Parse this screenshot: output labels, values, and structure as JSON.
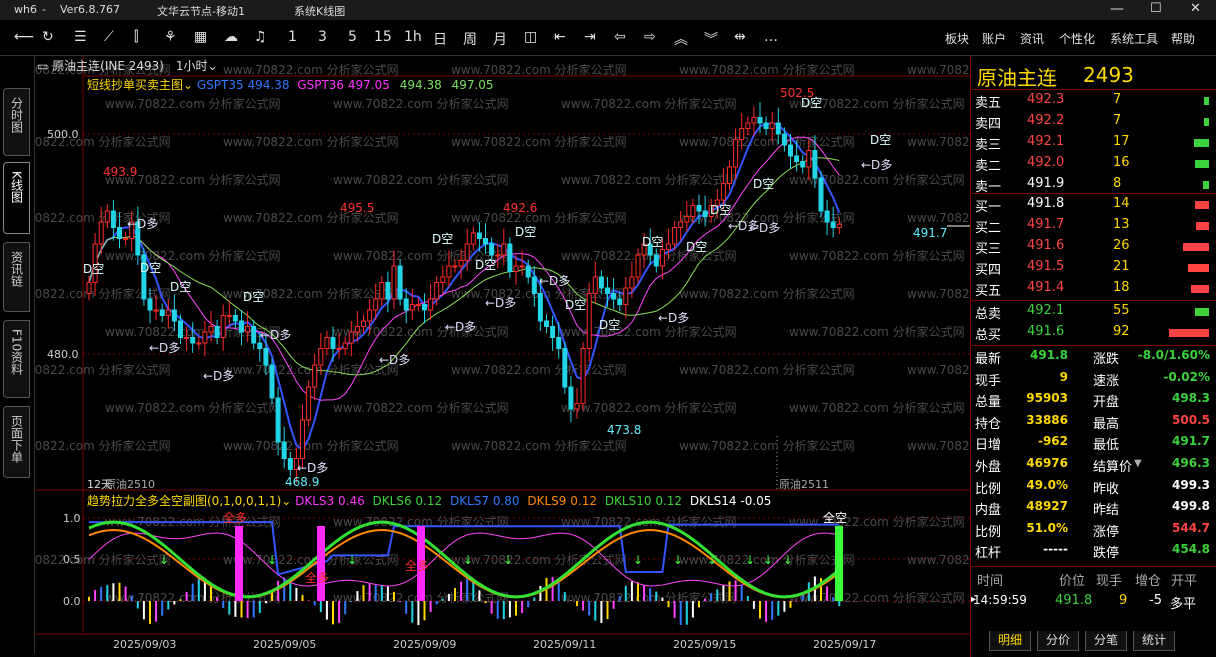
{
  "titlebar": {
    "user": "wh6",
    "dash": "-",
    "version": "Ver6.8.767",
    "node": "文华云节点-移动1",
    "view": "系统K线图",
    "minimize": "—",
    "maximize": "☐",
    "close": "✕"
  },
  "toolbar": {
    "periods": [
      "1",
      "3",
      "5",
      "15",
      "1h",
      "日",
      "周",
      "月"
    ],
    "menus": [
      "板块",
      "账户",
      "资讯",
      "个性化",
      "系统工具",
      "帮助"
    ],
    "more": "…"
  },
  "left_tabs": [
    "分时图",
    "K线图",
    "资讯链",
    "F10资料",
    "页面下单"
  ],
  "chart": {
    "symbol_title": "原油主连(INE 2493)",
    "interval": "1小时",
    "indicator_name": "短线抄单买卖主图",
    "indicator_values": [
      {
        "label": "GSPT35",
        "value": "494.38",
        "color": "#3377ff"
      },
      {
        "label": "GSPT36",
        "value": "497.05",
        "color": "#ff33ff"
      },
      {
        "label": "",
        "value": "494.38",
        "color": "#7be060"
      },
      {
        "label": "",
        "value": "497.05",
        "color": "#7be060"
      }
    ],
    "price_labels": [
      "500.0",
      "480.0"
    ],
    "annotations": [
      "502.5",
      "491.7",
      "473.8",
      "468.9",
      "492.6",
      "495.5",
      "493.9"
    ],
    "signals": {
      "short": "D空",
      "long": "←D多"
    },
    "contract_labels": [
      "12天",
      "原油2510",
      "原油2511"
    ],
    "sub_name": "趋势拉力全多全空副图(0,1,0,0,1,1)",
    "sub_values": [
      {
        "label": "DKLS3",
        "value": "0.46",
        "color": "#ff33ff"
      },
      {
        "label": "DKLS6",
        "value": "0.12",
        "color": "#3bd23b"
      },
      {
        "label": "DKLS7",
        "value": "0.80",
        "color": "#3377ff"
      },
      {
        "label": "DKLS9",
        "value": "0.12",
        "color": "#ff8800"
      },
      {
        "label": "DKLS10",
        "value": "0.12",
        "color": "#3bd23b"
      },
      {
        "label": "DKLS14",
        "value": "-0.05",
        "color": "#ffffff"
      }
    ],
    "sub_ticks": [
      "1.0",
      "0.5",
      "0.0"
    ],
    "sub_tags": [
      "全多",
      "全多",
      "全多",
      "全空"
    ],
    "dates": [
      "2025/09/03",
      "2025/09/05",
      "2025/09/09",
      "2025/09/11",
      "2025/09/15",
      "2025/09/17"
    ],
    "watermark": "www.70822.com 分析家公式网"
  },
  "quote": {
    "name": "原油主连",
    "code": "2493",
    "asks": [
      {
        "label": "卖五",
        "price": "492.3",
        "vol": "7"
      },
      {
        "label": "卖四",
        "price": "492.2",
        "vol": "7"
      },
      {
        "label": "卖三",
        "price": "492.1",
        "vol": "17"
      },
      {
        "label": "卖二",
        "price": "492.0",
        "vol": "16"
      },
      {
        "label": "卖一",
        "price": "491.9",
        "vol": "8"
      }
    ],
    "bids": [
      {
        "label": "买一",
        "price": "491.8",
        "vol": "14"
      },
      {
        "label": "买二",
        "price": "491.7",
        "vol": "13"
      },
      {
        "label": "买三",
        "price": "491.6",
        "vol": "26"
      },
      {
        "label": "买四",
        "price": "491.5",
        "vol": "21"
      },
      {
        "label": "买五",
        "price": "491.4",
        "vol": "18"
      }
    ],
    "totals": [
      {
        "label": "总卖",
        "price": "492.1",
        "vol": "55"
      },
      {
        "label": "总买",
        "price": "491.6",
        "vol": "92"
      }
    ],
    "stats_left": [
      {
        "label": "最新",
        "value": "491.8"
      },
      {
        "label": "现手",
        "value": "9"
      },
      {
        "label": "总量",
        "value": "95903"
      },
      {
        "label": "持仓",
        "value": "33886"
      },
      {
        "label": "日增",
        "value": "-962"
      },
      {
        "label": "外盘",
        "value": "46976"
      },
      {
        "label": "比例",
        "value": "49.0%"
      },
      {
        "label": "内盘",
        "value": "48927"
      },
      {
        "label": "比例",
        "value": "51.0%"
      },
      {
        "label": "杠杆",
        "value": "-----"
      }
    ],
    "stats_right": [
      {
        "label": "涨跌",
        "value": "-8.0/1.60%"
      },
      {
        "label": "速涨",
        "value": "-0.02%"
      },
      {
        "label": "开盘",
        "value": "498.3"
      },
      {
        "label": "最高",
        "value": "500.5"
      },
      {
        "label": "最低",
        "value": "491.7"
      },
      {
        "label": "结算价",
        "value": "496.3"
      },
      {
        "label": "昨收",
        "value": "499.3"
      },
      {
        "label": "昨结",
        "value": "499.8"
      },
      {
        "label": "涨停",
        "value": "544.7"
      },
      {
        "label": "跌停",
        "value": "454.8"
      }
    ],
    "tick_headers": [
      "时间",
      "价位",
      "现手",
      "增仓",
      "开平"
    ],
    "tick_row": {
      "time": "14:59:59",
      "price": "491.8",
      "vol": "9",
      "inc": "-5",
      "type": "多平"
    },
    "bottom_tabs": [
      "明细",
      "分价",
      "分笔",
      "统计"
    ]
  }
}
